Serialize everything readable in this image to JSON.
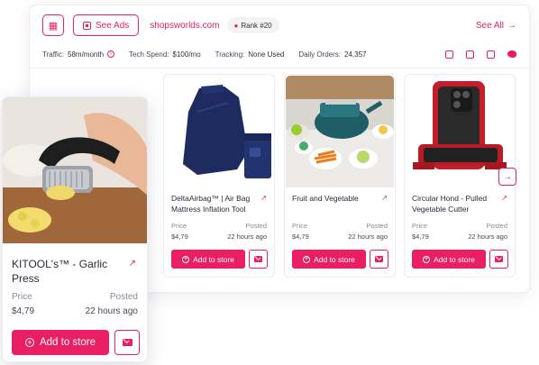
{
  "header": {
    "see_ads_label": "See Ads",
    "domain": "shopsworlds.com",
    "rank": "Rank #20",
    "see_all_label": "See All"
  },
  "stats": {
    "traffic_label": "Traffic:",
    "traffic_value": "58m/month",
    "tech_label": "Tech Spend:",
    "tech_value": "$100/mo",
    "tracking_label": "Tracking:",
    "tracking_value": "None Used",
    "orders_label": "Daily Orders:",
    "orders_value": "24,357"
  },
  "socials": [
    "youtube-icon",
    "instagram-icon",
    "facebook-icon",
    "twitter-icon"
  ],
  "cards": [
    {
      "title": "DeltaAirbag™ | Air Bag Mattress Inflation Tool",
      "price_label": "Price",
      "posted_label": "Posted",
      "price": "$4,79",
      "posted": "22 hours ago",
      "add_label": "Add to store"
    },
    {
      "title": "Fruit and Vegetable",
      "price_label": "Price",
      "posted_label": "Posted",
      "price": "$4,79",
      "posted": "22 hours ago",
      "add_label": "Add to store"
    },
    {
      "title": "Circular Hond - Pulled Vegetable Cutter",
      "price_label": "Price",
      "posted_label": "Posted",
      "price": "$4,79",
      "posted": "22 hours ago",
      "add_label": "Add to store"
    }
  ],
  "featured": {
    "title": "KITOOL's™ - Garlic Press",
    "price_label": "Price",
    "posted_label": "Posted",
    "price": "$4,79",
    "posted": "22 hours ago",
    "add_label": "Add to store"
  },
  "colors": {
    "accent": "#e91e63",
    "border": "#ececf2"
  }
}
